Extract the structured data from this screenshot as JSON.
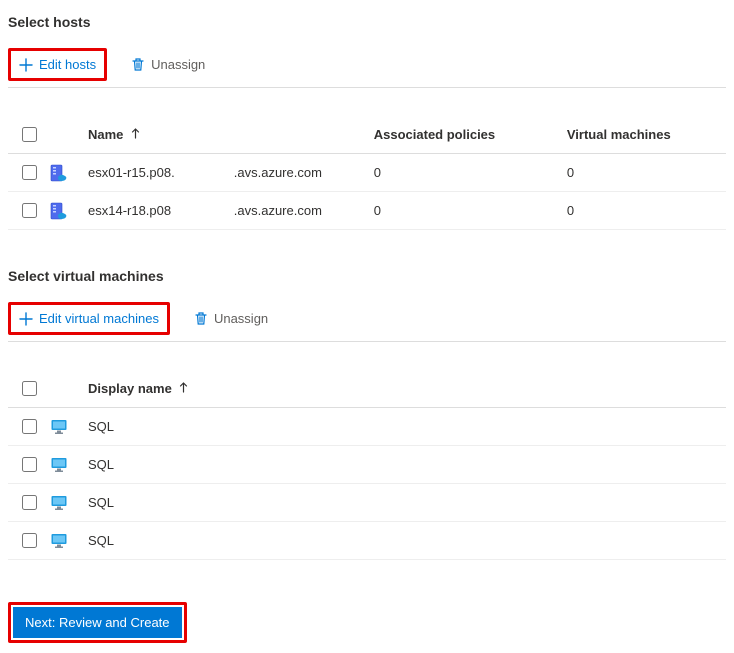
{
  "hosts_section": {
    "title": "Select hosts",
    "edit_btn": "Edit hosts",
    "unassign_btn": "Unassign",
    "columns": {
      "name": "Name",
      "assoc": "Associated policies",
      "vms": "Virtual machines"
    },
    "rows": [
      {
        "name": "esx01-r15.p08.",
        "domain": ".avs.azure.com",
        "assoc": "0",
        "vms": "0"
      },
      {
        "name": "esx14-r18.p08",
        "domain": ".avs.azure.com",
        "assoc": "0",
        "vms": "0"
      }
    ]
  },
  "vms_section": {
    "title": "Select virtual machines",
    "edit_btn": "Edit virtual machines",
    "unassign_btn": "Unassign",
    "columns": {
      "display_name": "Display name"
    },
    "rows": [
      {
        "name": "SQL"
      },
      {
        "name": "SQL"
      },
      {
        "name": "SQL"
      },
      {
        "name": "SQL"
      }
    ]
  },
  "footer": {
    "next_btn": "Next: Review and Create"
  }
}
